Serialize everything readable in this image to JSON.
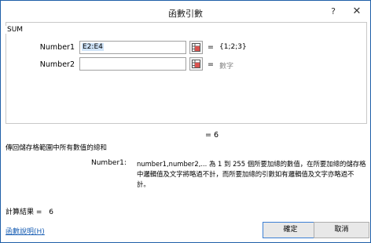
{
  "dialog": {
    "title": "函數引數",
    "help_label": "?",
    "close_label": "✕"
  },
  "function": {
    "name": "SUM"
  },
  "args": [
    {
      "label": "Number1",
      "value": "E2:E4",
      "result": "{1;2;3}"
    },
    {
      "label": "Number2",
      "value": "",
      "result": "數字"
    }
  ],
  "equals": "=",
  "formula_result": "= 6",
  "description": "傳回儲存格範圍中所有數值的總和",
  "arg_help": {
    "label": "Number1:",
    "text": "number1,number2,... 為 1 到 255 個所要加總的數值，在所要加總的儲存格中邏輯值及文字將略過不計，而所要加總的引數如有邏輯值及文字亦略過不計。"
  },
  "calc_result": {
    "label": "計算結果 =",
    "value": "6"
  },
  "help_link": "函數說明(H)",
  "buttons": {
    "ok": "確定",
    "cancel": "取消"
  },
  "icons": [
    "help-icon",
    "close-icon",
    "range-select-icon"
  ]
}
